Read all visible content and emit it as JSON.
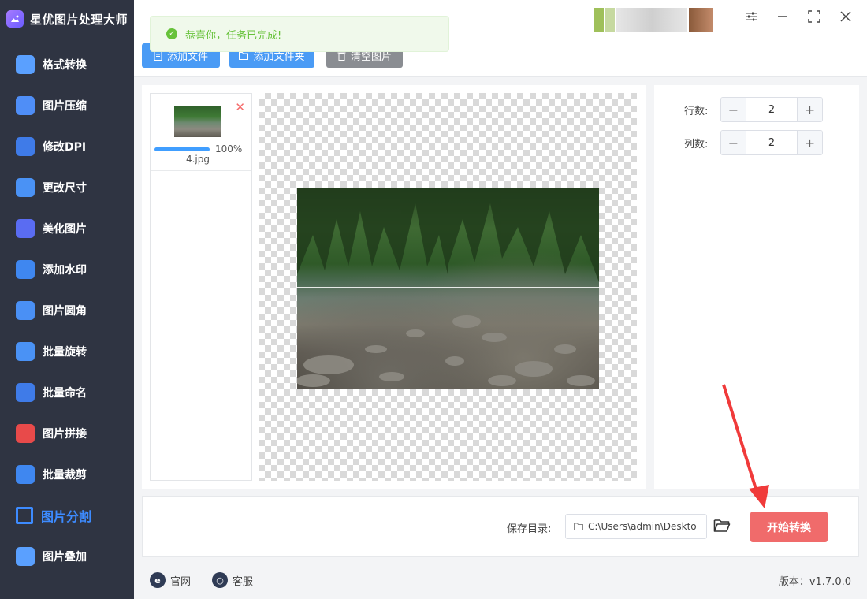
{
  "app": {
    "title": "星优图片处理大师"
  },
  "sidebar": {
    "items": [
      {
        "label": "格式转换",
        "icon": "image-convert-icon",
        "color": "#5aa0ff"
      },
      {
        "label": "图片压缩",
        "icon": "image-compress-icon",
        "color": "#4f8ef7"
      },
      {
        "label": "修改DPI",
        "icon": "dpi-icon",
        "color": "#3f7be8"
      },
      {
        "label": "更改尺寸",
        "icon": "resize-icon",
        "color": "#4a92f5"
      },
      {
        "label": "美化图片",
        "icon": "beautify-icon",
        "color": "#5a6cf2"
      },
      {
        "label": "添加水印",
        "icon": "watermark-icon",
        "color": "#3f87f0"
      },
      {
        "label": "图片圆角",
        "icon": "round-corner-icon",
        "color": "#4a90f5"
      },
      {
        "label": "批量旋转",
        "icon": "rotate-icon",
        "color": "#4a92f5"
      },
      {
        "label": "批量命名",
        "icon": "rename-icon",
        "color": "#3f7be8"
      },
      {
        "label": "图片拼接",
        "icon": "stitch-icon",
        "color": "#e84a4a"
      },
      {
        "label": "批量裁剪",
        "icon": "crop-icon",
        "color": "#3f87f0"
      },
      {
        "label": "图片分割",
        "icon": "split-icon",
        "color": "#3d8bff",
        "active": true
      },
      {
        "label": "图片叠加",
        "icon": "layers-icon",
        "color": "#5aa0ff"
      }
    ]
  },
  "toolbar": {
    "add_file": "添加文件",
    "add_folder": "添加文件夹",
    "clear_images": "清空图片"
  },
  "toast": {
    "message": "恭喜你，任务已完成!"
  },
  "file": {
    "name": "4.jpg",
    "progress_label": "100%",
    "progress": 1.0
  },
  "settings": {
    "rows_label": "行数:",
    "rows_value": "2",
    "cols_label": "列数:",
    "cols_value": "2"
  },
  "save": {
    "label": "保存目录:",
    "path": "C:\\Users\\admin\\Deskto",
    "start_button": "开始转换"
  },
  "footer": {
    "website": "官网",
    "support": "客服",
    "version": "版本：v1.7.0.0"
  },
  "colors": {
    "accent": "#3d8bff",
    "start_button": "#f06b6b",
    "toast_text": "#67c23a"
  }
}
